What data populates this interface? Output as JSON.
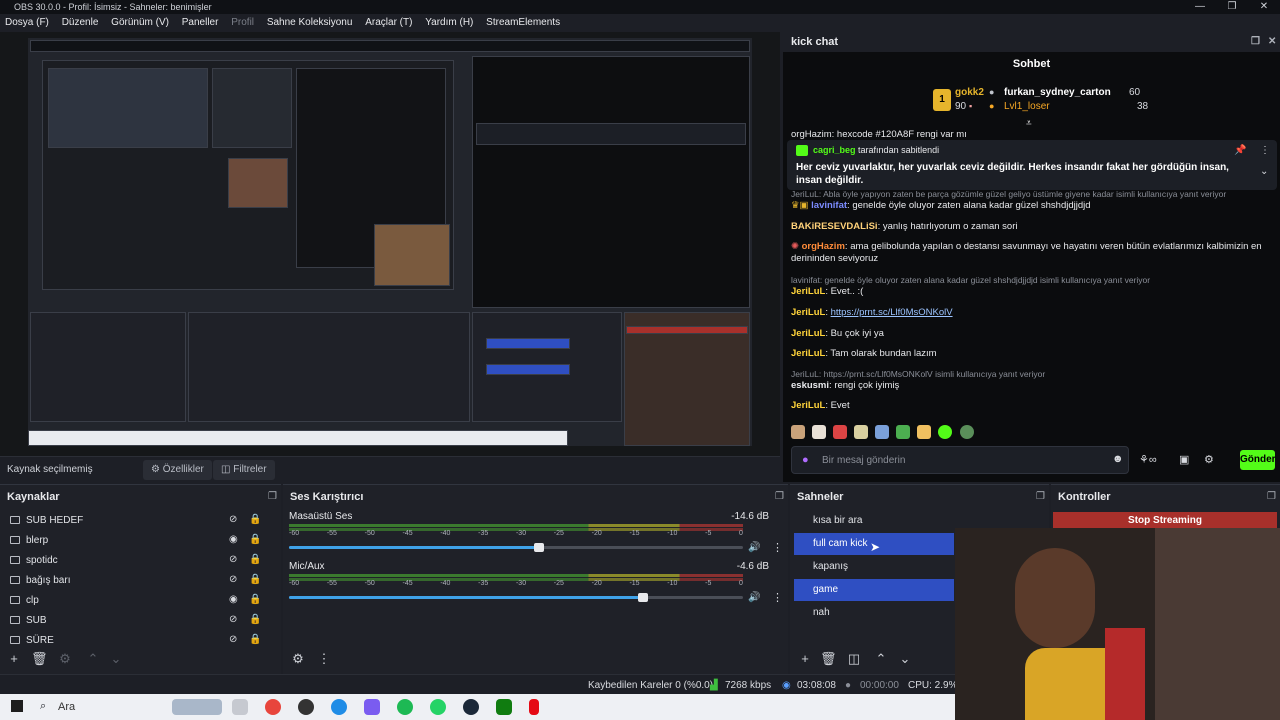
{
  "window": {
    "title": "OBS 30.0.0 - Profil: İsimsiz - Sahneler: benimişler",
    "controls": [
      "—",
      "❐",
      "✕"
    ]
  },
  "menu": [
    "Dosya (F)",
    "Düzenle",
    "Görünüm (V)",
    "Paneller",
    "Profil",
    "Sahne Koleksiyonu",
    "Araçlar (T)",
    "Yardım (H)",
    "StreamElements"
  ],
  "source_bar": {
    "status": "Kaynak seçilmemiş",
    "properties_label": "Özellikler",
    "filters_label": "Filtreler"
  },
  "chat": {
    "dock_title": "kick chat",
    "header": "Sohbet",
    "leaderboard": {
      "first": {
        "name": "gokk2",
        "value": "90"
      },
      "second": {
        "name": "furkan_sydney_carton",
        "value": "60"
      },
      "third": {
        "name": "Lvl1_loser",
        "value": "38"
      }
    },
    "cut_top_line": "orgHazim: hexcode #120A8F rengi var mı",
    "pinned": {
      "user": "cagri_beg",
      "suffix": "tarafından sabitlendi",
      "text": "Her ceviz yuvarlaktır, her yuvarlak ceviz değildir. Herkes insandır fakat her gördüğün insan, insan değildir."
    },
    "messages": [
      {
        "type": "reply",
        "text": "JeriLuL: Abla öyle yapıyon zaten be parça gözümle güzel geliyo üstümle giyene kadar isimli kullanıcıya yanıt veriyor"
      },
      {
        "user": "lavinifat",
        "text": "genelde öyle oluyor zaten alana kadar güzel shshdjdjjdjd"
      },
      {
        "user": "BAKiRESEVDALiSi",
        "text": "yanlış hatırlıyorum o zaman sori"
      },
      {
        "user": "orgHazim",
        "text": "ama gelibolunda yapılan o destansı savunmayı ve hayatını veren bütün evlatlarımızı kalbimizin en derininden seviyoruz"
      },
      {
        "type": "reply",
        "text": "lavinifat: genelde öyle oluyor zaten alana kadar güzel shshdjdjjdjd isimli kullanıcıya yanıt veriyor"
      },
      {
        "user": "JeriLuL",
        "text": "Evet.. :("
      },
      {
        "user": "JeriLuL",
        "text": "https://prnt.sc/Llf0MsONKolV"
      },
      {
        "user": "JeriLuL",
        "text": "Bu çok iyi ya"
      },
      {
        "user": "JeriLuL",
        "text": "Tam olarak bundan lazım"
      },
      {
        "type": "reply",
        "text": "JeriLuL: https://prnt.sc/Llf0MsONKolV isimli kullanıcıya yanıt veriyor"
      },
      {
        "user": "eskusmi",
        "text": "rengi çok iyimiş"
      },
      {
        "user": "JeriLuL",
        "text": "Evet"
      }
    ],
    "input_placeholder": "Bir mesaj gönderin",
    "send_label": "Gönder"
  },
  "sources": {
    "title": "Kaynaklar",
    "items": [
      {
        "name": "SUB HEDEF",
        "visible": false
      },
      {
        "name": "blerp",
        "visible": true
      },
      {
        "name": "spotidc",
        "visible": false
      },
      {
        "name": "bağış barı",
        "visible": false
      },
      {
        "name": "clp",
        "visible": true
      },
      {
        "name": "SUB",
        "visible": false
      },
      {
        "name": "SÜRE",
        "visible": false
      }
    ]
  },
  "mixer": {
    "title": "Ses Karıştırıcı",
    "ticks": [
      "-60",
      "-55",
      "-50",
      "-45",
      "-40",
      "-35",
      "-30",
      "-25",
      "-20",
      "-15",
      "-10",
      "-5",
      "0"
    ],
    "channels": [
      {
        "name": "Masaüstü Ses",
        "db": "-14.6 dB",
        "volume": 0.55
      },
      {
        "name": "Mic/Aux",
        "db": "-4.6 dB",
        "volume": 0.78
      }
    ]
  },
  "scenes": {
    "title": "Sahneler",
    "items": [
      {
        "name": "kısa bir ara",
        "selected": false
      },
      {
        "name": "full cam kick",
        "selected": true
      },
      {
        "name": "kapanış",
        "selected": false
      },
      {
        "name": "game",
        "selected": true
      },
      {
        "name": "nah",
        "selected": false
      }
    ]
  },
  "controls": {
    "title": "Kontroller",
    "stop_streaming": "Stop Streaming"
  },
  "status": {
    "dropped": "Kaybedilen Kareler 0 (%0.0)",
    "bitrate": "7268 kbps",
    "stream_time": "03:08:08",
    "rec_time": "00:00:00",
    "cpu": "CPU: 2.9%"
  },
  "taskbar": {
    "search": "Ara"
  },
  "colors": {
    "accent_green": "#53fc18",
    "scene_selected": "#2f4fc2",
    "stop_red": "#a8302b"
  }
}
